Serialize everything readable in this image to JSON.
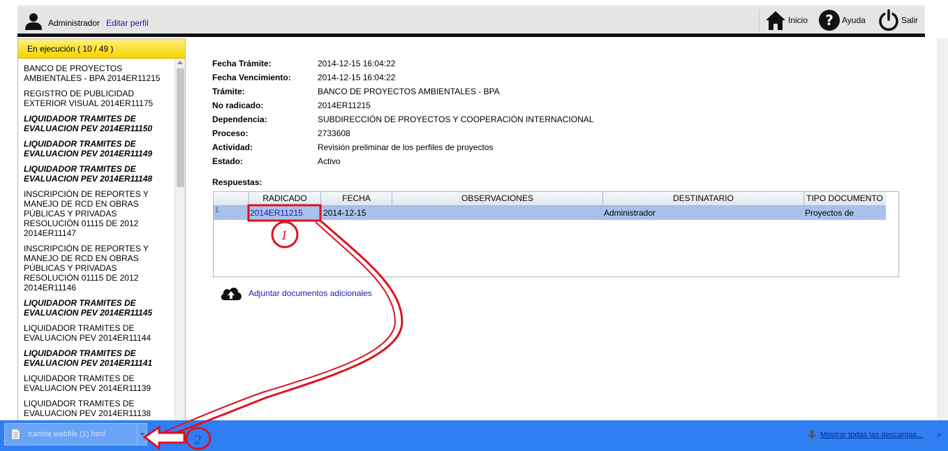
{
  "header": {
    "user_name": "Administrador",
    "edit_profile": "Editar perfil",
    "nav": {
      "home": "Inicio",
      "help": "Ayuda",
      "logout": "Salir"
    }
  },
  "sidebar": {
    "header": "En ejecución ( 10 / 49 )",
    "items": [
      {
        "text": "BANCO DE PROYECTOS AMBIENTALES - BPA 2014ER11215",
        "bold": false
      },
      {
        "text": "REGISTRO DE PUBLICIDAD EXTERIOR VISUAL 2014ER11175",
        "bold": false
      },
      {
        "text": "LIQUIDADOR TRAMITES DE EVALUACION PEV 2014ER11150",
        "bold": true
      },
      {
        "text": "LIQUIDADOR TRAMITES DE EVALUACION PEV 2014ER11149",
        "bold": true
      },
      {
        "text": "LIQUIDADOR TRAMITES DE EVALUACION PEV 2014ER11148",
        "bold": true
      },
      {
        "text": "INSCRIPCIÓN DE REPORTES Y MANEJO DE RCD EN OBRAS PÚBLICAS Y PRIVADAS RESOLUCIÓN 01115 DE 2012 2014ER11147",
        "bold": false
      },
      {
        "text": "INSCRIPCIÓN DE REPORTES Y MANEJO DE RCD EN OBRAS PÚBLICAS Y PRIVADAS RESOLUCIÓN 01115 DE 2012 2014ER11146",
        "bold": false
      },
      {
        "text": "LIQUIDADOR TRAMITES DE EVALUACION PEV 2014ER11145",
        "bold": true
      },
      {
        "text": "LIQUIDADOR TRAMITES DE EVALUACION PEV 2014ER11144",
        "bold": false
      },
      {
        "text": "LIQUIDADOR TRAMITES DE EVALUACION PEV 2014ER11141",
        "bold": true
      },
      {
        "text": "LIQUIDADOR TRAMITES DE EVALUACION PEV 2014ER11139",
        "bold": false
      },
      {
        "text": "LIQUIDADOR TRAMITES DE EVALUACION PEV 2014ER11138",
        "bold": false
      }
    ]
  },
  "details": [
    {
      "label": "Fecha Trámite:",
      "value": "2014-12-15 16:04:22"
    },
    {
      "label": "Fecha Vencimiento:",
      "value": "2014-12-15 16:04:22"
    },
    {
      "label": "Trámite:",
      "value": "BANCO DE PROYECTOS AMBIENTALES - BPA"
    },
    {
      "label": "No radicado:",
      "value": "2014ER11215"
    },
    {
      "label": "Dependencia:",
      "value": "SUBDIRECCIÓN DE PROYECTOS Y COOPERACIÓN INTERNACIONAL"
    },
    {
      "label": "Proceso:",
      "value": "2733608"
    },
    {
      "label": "Actividad:",
      "value": "Revisión preliminar de los perfiles de proyectos"
    },
    {
      "label": "Estado:",
      "value": "Activo"
    }
  ],
  "responses": {
    "label": "Respuestas:",
    "columns": [
      "RADICADO",
      "FECHA",
      "OBSERVACIONES",
      "DESTINATARIO",
      "TIPO DOCUMENTO"
    ],
    "rows": [
      {
        "num": "1",
        "radicado": "2014ER11215",
        "fecha": "2014-12-15",
        "observaciones": "",
        "destinatario": "Administrador",
        "tipo": "Proyectos de"
      }
    ]
  },
  "attach_label": "Adjuntar documentos adicionales",
  "download_bar": {
    "file_name": "tramite webfile (1).html",
    "show_all": "Mostrar todas las descargas...",
    "close": "×"
  },
  "annotations": {
    "step1": "1",
    "step2": "2"
  },
  "colors": {
    "annotation": "#e01020",
    "download_bar": "#2f7ef2",
    "selected_row": "#a9c1ea",
    "sidebar_header": "#f7d200"
  }
}
